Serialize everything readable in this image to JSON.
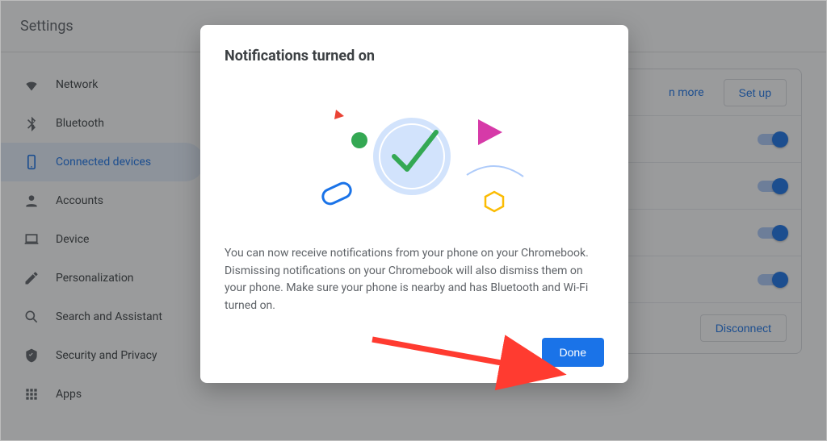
{
  "header": {
    "title": "Settings"
  },
  "sidebar": {
    "items": [
      {
        "label": "Network",
        "icon": "wifi-icon"
      },
      {
        "label": "Bluetooth",
        "icon": "bluetooth-icon"
      },
      {
        "label": "Connected devices",
        "icon": "phone-icon",
        "active": true
      },
      {
        "label": "Accounts",
        "icon": "person-icon"
      },
      {
        "label": "Device",
        "icon": "laptop-icon"
      },
      {
        "label": "Personalization",
        "icon": "pen-icon"
      },
      {
        "label": "Search and Assistant",
        "icon": "search-icon"
      },
      {
        "label": "Security and Privacy",
        "icon": "shield-icon"
      },
      {
        "label": "Apps",
        "icon": "apps-grid-icon"
      }
    ]
  },
  "main": {
    "top": {
      "learn_more": "n more",
      "setup_label": "Set up"
    },
    "toggles": [
      true,
      true,
      true,
      true
    ],
    "disconnect_label": "Disconnect"
  },
  "dialog": {
    "title": "Notifications turned on",
    "body": "You can now receive notifications from your phone on your Chromebook. Dismissing notifications on your Chromebook will also dismiss them on your phone. Make sure your phone is nearby and has Bluetooth and Wi-Fi turned on.",
    "done_label": "Done"
  },
  "colors": {
    "primary": "#1a73e8",
    "text_secondary": "#5f6368",
    "annotation": "#ff3b30"
  }
}
